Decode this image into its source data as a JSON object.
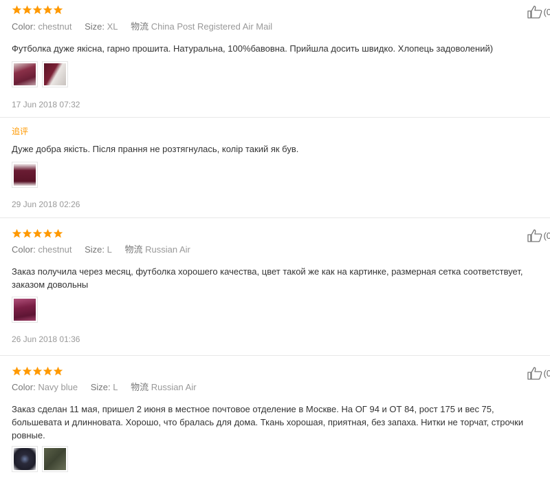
{
  "reviews": [
    {
      "color_label": "Color:",
      "color_value": "chestnut",
      "size_label": "Size:",
      "size_value": "XL",
      "ship_label": "物流",
      "ship_value": "China Post Registered Air Mail",
      "text": "Футболка дуже якісна, гарно прошита. Натуральна, 100%бавовна. Прийшла досить швидко. Хлопець задоволений)",
      "date": "17 Jun 2018 07:32",
      "like_count": "(0",
      "followup": {
        "label": "追评",
        "text": "Дуже добра якість. Після прання не розтягнулась, колір такий як був.",
        "date": "29 Jun 2018 02:26"
      }
    },
    {
      "color_label": "Color:",
      "color_value": "chestnut",
      "size_label": "Size:",
      "size_value": "L",
      "ship_label": "物流",
      "ship_value": "Russian Air",
      "text": "Заказ получила через месяц, футболка хорошего качества, цвет такой же как на картинке, размерная сетка соответствует, заказом довольны",
      "date": "26 Jun 2018 01:36",
      "like_count": "(0"
    },
    {
      "color_label": "Color:",
      "color_value": "Navy blue",
      "size_label": "Size:",
      "size_value": "L",
      "ship_label": "物流",
      "ship_value": "Russian Air",
      "text": "Заказ сделан 11 мая, пришел 2 июня в местное почтовое отделение в Москве. На ОГ 94 и ОТ 84, рост 175 и вес 75, большевата и длинновата. Хорошо, что бралась для дома. Ткань хорошая, приятная, без запаха. Нитки не торчат, строчки ровные.",
      "like_count": "(0"
    }
  ],
  "star_rating": 5,
  "colors": {
    "star": "#f90",
    "followup": "#f90",
    "text": "#333",
    "meta": "#999"
  },
  "icons": {
    "star": "star-icon",
    "like": "thumbs-up-icon"
  }
}
